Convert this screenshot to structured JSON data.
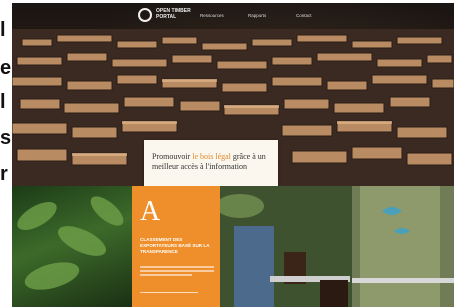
{
  "left_cropped_text": [
    "l",
    "e",
    "l",
    "s",
    "r"
  ],
  "nav": {
    "logo_text_line1": "OPEN TIMBER",
    "logo_text_line2": "PORTAL",
    "links": [
      "Ressources",
      "Rapports",
      "Contact"
    ]
  },
  "hero": {
    "callout_prefix": "Promouvoir ",
    "callout_highlight": "le bois légal",
    "callout_suffix": " grâce à un meilleur accès à l'information"
  },
  "feature": {
    "letter": "A",
    "title": "CLASSEMENT DES EXPORTATEURS BASÉ SUR LA TRANSPARENCE"
  },
  "colors": {
    "accent_orange": "#ef8f2b",
    "callout_highlight": "#e08a2a"
  }
}
